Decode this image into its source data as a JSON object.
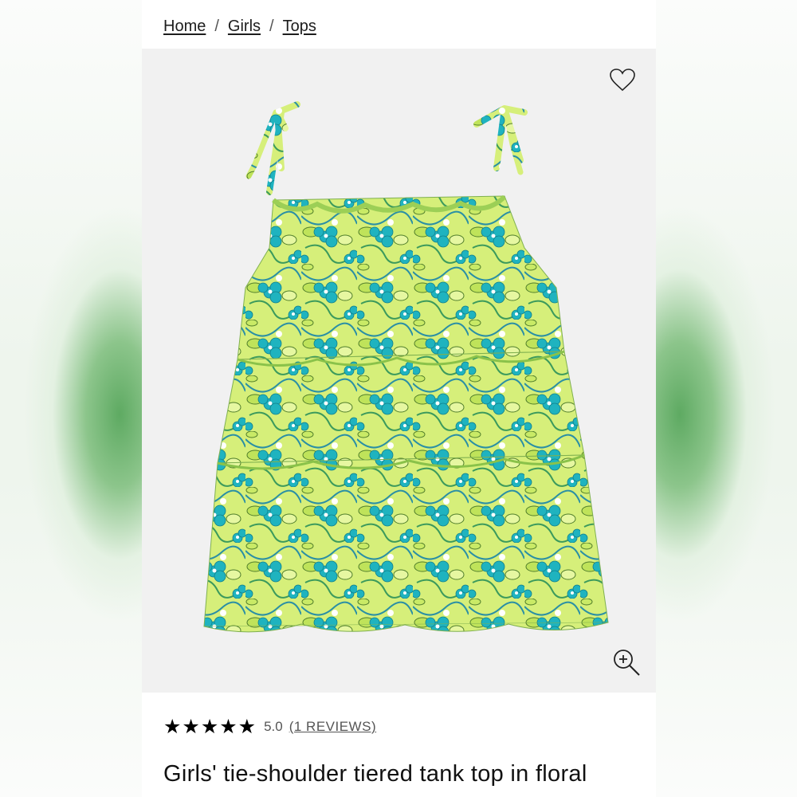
{
  "breadcrumb": {
    "items": [
      "Home",
      "Girls",
      "Tops"
    ],
    "separator": "/"
  },
  "product": {
    "image_alt": "Girls' tie-shoulder tiered tank top in floral",
    "wishlist_icon": "heart-outline-icon",
    "zoom_icon": "zoom-in-icon",
    "rating": {
      "stars": "★★★★★",
      "score": "5.0",
      "reviews_label": "(1 REVIEWS)"
    },
    "title": "Girls' tie-shoulder tiered tank top in floral"
  },
  "colors": {
    "fabric_green": "#c5e85a",
    "flower_teal": "#1fb3bf",
    "side_green": "#7fbf7c"
  }
}
